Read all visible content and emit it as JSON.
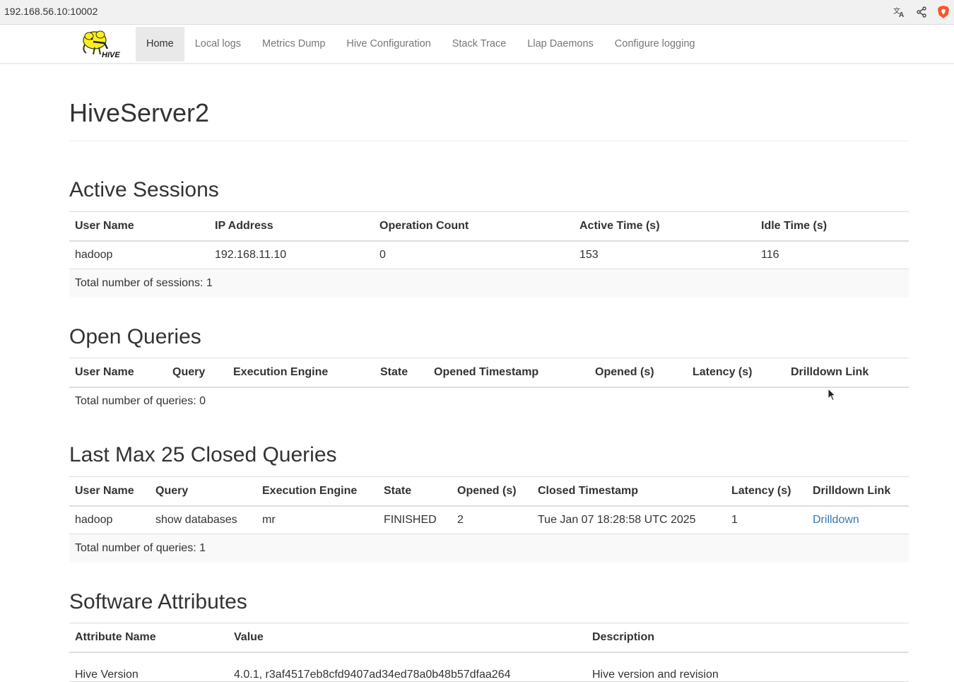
{
  "browser": {
    "url": "192.168.56.10:10002"
  },
  "navbar": {
    "logo_text": "HIVE",
    "links": [
      {
        "label": "Home",
        "active": true
      },
      {
        "label": "Local logs"
      },
      {
        "label": "Metrics Dump"
      },
      {
        "label": "Hive Configuration"
      },
      {
        "label": "Stack Trace"
      },
      {
        "label": "Llap Daemons"
      },
      {
        "label": "Configure logging"
      }
    ]
  },
  "page": {
    "title": "HiveServer2"
  },
  "active_sessions": {
    "title": "Active Sessions",
    "headers": [
      "User Name",
      "IP Address",
      "Operation Count",
      "Active Time (s)",
      "Idle Time (s)"
    ],
    "rows": [
      [
        "hadoop",
        "192.168.11.10",
        "0",
        "153",
        "116"
      ]
    ],
    "total": "Total number of sessions: 1"
  },
  "open_queries": {
    "title": "Open Queries",
    "headers": [
      "User Name",
      "Query",
      "Execution Engine",
      "State",
      "Opened Timestamp",
      "Opened (s)",
      "Latency (s)",
      "Drilldown Link"
    ],
    "total": "Total number of queries: 0"
  },
  "closed_queries": {
    "title": "Last Max 25 Closed Queries",
    "headers": [
      "User Name",
      "Query",
      "Execution Engine",
      "State",
      "Opened (s)",
      "Closed Timestamp",
      "Latency (s)",
      "Drilldown Link"
    ],
    "rows": [
      [
        "hadoop",
        "show databases",
        "mr",
        "FINISHED",
        "2",
        "Tue Jan 07 18:28:58 UTC 2025",
        "1",
        "Drilldown"
      ]
    ],
    "total": "Total number of queries: 1"
  },
  "software_attributes": {
    "title": "Software Attributes",
    "headers": [
      "Attribute Name",
      "Value",
      "Description"
    ],
    "rows": [
      [
        "Hive Version",
        "4.0.1, r3af4517eb8cfd9407ad34ed78a0b48b57dfaa264",
        "Hive version and revision"
      ]
    ]
  },
  "colors": {
    "link": "#337ab7",
    "nav_active_bg": "#e9e9e9",
    "total_row_bg": "#f9f9f9",
    "brave_orange": "#fb542b"
  },
  "icons": {
    "translate": "translate-icon",
    "share": "share-icon",
    "brave": "brave-shield-icon",
    "cursor": "mouse-cursor-icon"
  }
}
